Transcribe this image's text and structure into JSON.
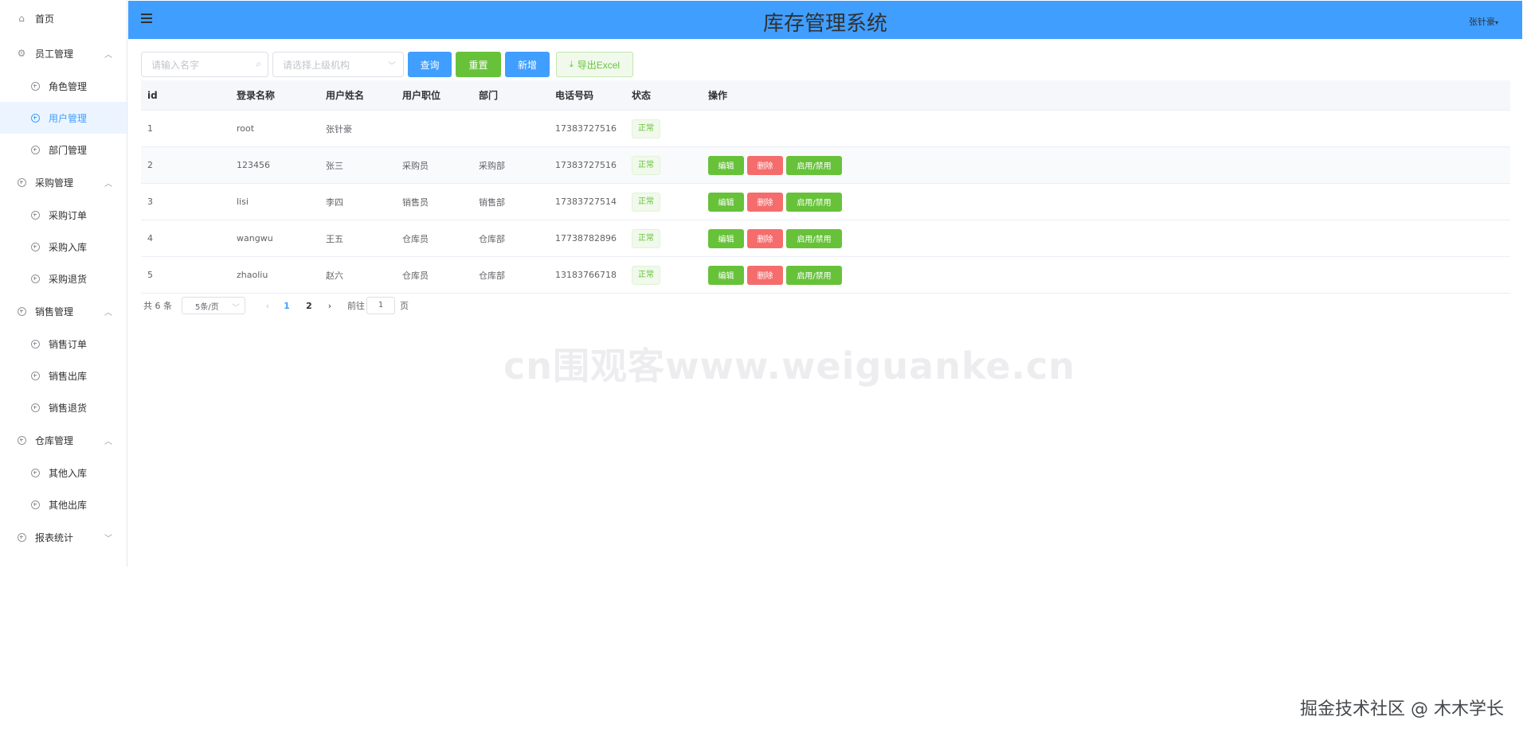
{
  "header": {
    "title": "库存管理系统",
    "user": "张针豪"
  },
  "sidebar": {
    "home": "首页",
    "groups": [
      {
        "label": "员工管理",
        "items": [
          "角色管理",
          "用户管理",
          "部门管理"
        ]
      },
      {
        "label": "采购管理",
        "items": [
          "采购订单",
          "采购入库",
          "采购退货"
        ]
      },
      {
        "label": "销售管理",
        "items": [
          "销售订单",
          "销售出库",
          "销售退货"
        ]
      },
      {
        "label": "仓库管理",
        "items": [
          "其他入库",
          "其他出库"
        ]
      },
      {
        "label": "报表统计",
        "items": []
      }
    ],
    "active_item": "用户管理"
  },
  "toolbar": {
    "search_placeholder": "请输入名字",
    "org_placeholder": "请选择上级机构",
    "query_label": "查询",
    "reset_label": "重置",
    "add_label": "新增",
    "export_label": "导出Excel"
  },
  "table": {
    "headers": [
      "id",
      "登录名称",
      "用户姓名",
      "用户职位",
      "部门",
      "电话号码",
      "状态",
      "操作"
    ],
    "rows": [
      {
        "id": "1",
        "login": "root",
        "name": "张针豪",
        "position": "",
        "dept": "",
        "phone": "17383727516",
        "status": "正常",
        "has_actions": false
      },
      {
        "id": "2",
        "login": "123456",
        "name": "张三",
        "position": "采购员",
        "dept": "采购部",
        "phone": "17383727516",
        "status": "正常",
        "has_actions": true
      },
      {
        "id": "3",
        "login": "lisi",
        "name": "李四",
        "position": "销售员",
        "dept": "销售部",
        "phone": "17383727514",
        "status": "正常",
        "has_actions": true
      },
      {
        "id": "4",
        "login": "wangwu",
        "name": "王五",
        "position": "仓库员",
        "dept": "仓库部",
        "phone": "17738782896",
        "status": "正常",
        "has_actions": true
      },
      {
        "id": "5",
        "login": "zhaoliu",
        "name": "赵六",
        "position": "仓库员",
        "dept": "仓库部",
        "phone": "13183766718",
        "status": "正常",
        "has_actions": true
      }
    ],
    "actions": {
      "edit": "编辑",
      "delete": "删除",
      "toggle": "启用/禁用"
    }
  },
  "pagination": {
    "total_label": "共 6 条",
    "page_size": "5条/页",
    "pages": [
      "1",
      "2"
    ],
    "current_page": "1",
    "goto_label": "前往",
    "goto_value": "1",
    "page_suffix": "页"
  },
  "watermarks": {
    "center": "cn围观客www.weiguanke.cn",
    "corner": "掘金技术社区 @ 木木学长"
  },
  "colors": {
    "primary": "#409eff",
    "success": "#67c23a",
    "danger": "#f56c6c"
  }
}
